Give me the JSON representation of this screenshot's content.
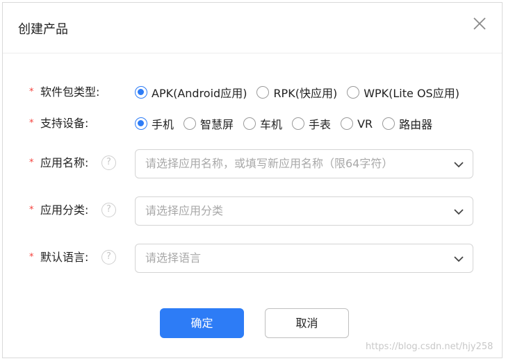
{
  "dialog": {
    "title": "创建产品"
  },
  "form": {
    "package_type": {
      "label": "软件包类型:",
      "required_mark": "*",
      "options": [
        {
          "label": "APK(Android应用)",
          "checked": true
        },
        {
          "label": "RPK(快应用)",
          "checked": false
        },
        {
          "label": "WPK(Lite OS应用)",
          "checked": false
        }
      ]
    },
    "devices": {
      "label": "支持设备:",
      "required_mark": "*",
      "options": [
        {
          "label": "手机",
          "checked": true
        },
        {
          "label": "智慧屏",
          "checked": false
        },
        {
          "label": "车机",
          "checked": false
        },
        {
          "label": "手表",
          "checked": false
        },
        {
          "label": "VR",
          "checked": false
        },
        {
          "label": "路由器",
          "checked": false
        }
      ]
    },
    "app_name": {
      "label": "应用名称:",
      "required_mark": "*",
      "help": "?",
      "placeholder": "请选择应用名称，或填写新应用名称（限64字符）"
    },
    "app_category": {
      "label": "应用分类:",
      "required_mark": "*",
      "help": "?",
      "placeholder": "请选择应用分类"
    },
    "default_language": {
      "label": "默认语言:",
      "required_mark": "*",
      "help": "?",
      "placeholder": "请选择语言"
    }
  },
  "buttons": {
    "confirm": "确定",
    "cancel": "取消"
  },
  "watermark": "https://blog.csdn.net/hjy258",
  "colors": {
    "accent": "#2d7cf6",
    "required": "#f5413c"
  },
  "icons": {
    "close": "close-icon",
    "chevron": "chevron-down-icon",
    "help": "help-icon"
  }
}
